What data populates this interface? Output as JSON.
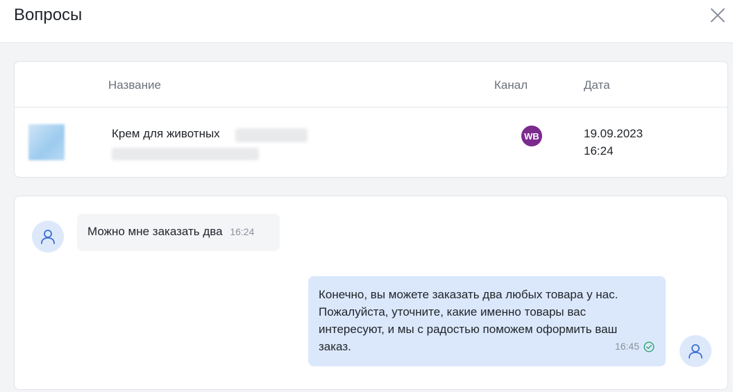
{
  "header": {
    "title": "Вопросы"
  },
  "table": {
    "columns": {
      "name": "Название",
      "channel": "Канал",
      "date": "Дата"
    },
    "row": {
      "product_name": "Крем для животных",
      "channel_badge": "WB",
      "date": "19.09.2023",
      "time": "16:24"
    }
  },
  "chat": {
    "incoming": {
      "text": "Можно мне заказать два",
      "time": "16:24"
    },
    "outgoing": {
      "lines": [
        "Конечно, вы можете заказать два любых товара у нас.",
        "Пожалуйста, уточните, какие именно товары вас",
        "интересуют, и мы с радостью поможем оформить ваш",
        "заказ."
      ],
      "time": "16:45",
      "status_icon": "check-circle-icon"
    }
  },
  "colors": {
    "wb_brand": "#7b2a8e",
    "outgoing_bubble": "#dbe8fc",
    "incoming_bubble": "#f4f5f7",
    "avatar_bg": "#dde9fa",
    "read_check": "#2ea36a"
  }
}
